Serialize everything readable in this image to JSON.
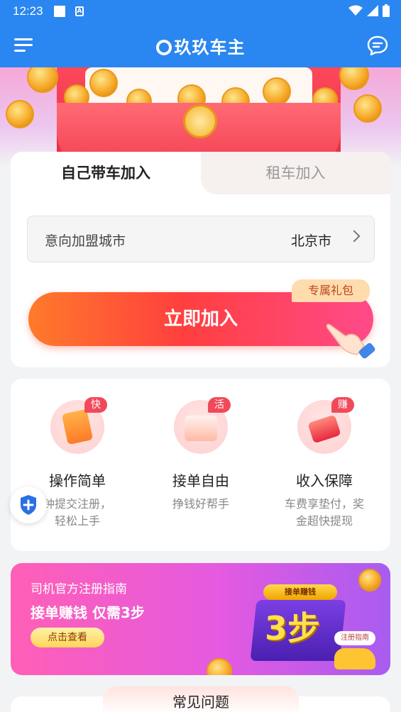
{
  "status_bar": {
    "time": "12:23",
    "icons": [
      "notification-square-icon",
      "font-a-icon",
      "wifi-icon",
      "signal-icon",
      "battery-icon"
    ]
  },
  "header": {
    "title": "玖玖车主",
    "menu_icon": "menu-icon",
    "chat_icon": "chat-bubble-icon"
  },
  "join_card": {
    "tabs": [
      {
        "label": "自己带车加入",
        "active": true
      },
      {
        "label": "租车加入",
        "active": false
      }
    ],
    "city_label": "意向加盟城市",
    "city_value": "北京市",
    "join_button": "立即加入",
    "gift_badge": "专属礼包"
  },
  "features": [
    {
      "badge": "快",
      "title": "操作简单",
      "desc_lines": [
        "钟提交注册，",
        "轻松上手"
      ]
    },
    {
      "badge": "活",
      "title": "接单自由",
      "desc_lines": [
        "挣钱好帮手"
      ]
    },
    {
      "badge": "赚",
      "title": "收入保障",
      "desc_lines": [
        "车费享垫付，奖",
        "金超快提现"
      ]
    }
  ],
  "guide_banner": {
    "subtitle": "司机官方注册指南",
    "title": "接单赚钱 仅需3步",
    "button": "点击查看",
    "art_ribbon": "接单赚钱",
    "art_text": "3步",
    "art_tag": "注册指南"
  },
  "faq": {
    "title": "常见问题"
  },
  "colors": {
    "primary_blue": "#2a86f0",
    "join_gradient_start": "#ff7a2a",
    "join_gradient_end": "#ff4a8a",
    "badge_red": "#f04a5a"
  }
}
